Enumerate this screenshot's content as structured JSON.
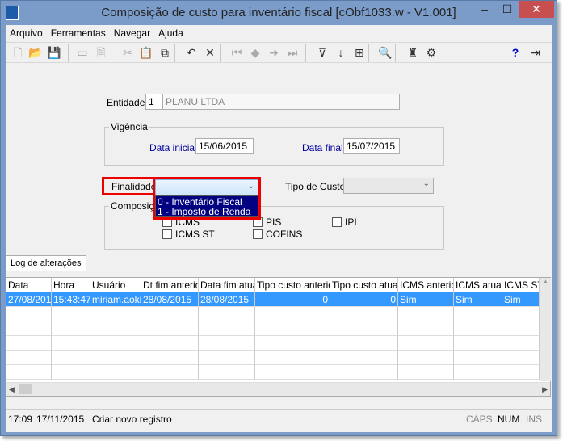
{
  "window": {
    "title": "Composição de custo para inventário fiscal [cObf1033.w - V1.001]"
  },
  "menu": [
    "Arquivo",
    "Ferramentas",
    "Navegar",
    "Ajuda"
  ],
  "toolbar": {
    "icons": [
      "new-icon",
      "open-icon",
      "save-icon",
      "window-icon",
      "properties-icon",
      "cut-icon",
      "paste-icon",
      "copy-icon",
      "undo-icon",
      "delete-icon",
      "first-icon",
      "prev-icon",
      "next-icon",
      "last-icon",
      "filter-icon",
      "sort-icon",
      "export-icon",
      "preview-icon",
      "find-icon",
      "config-icon",
      "help-icon",
      "exit-icon"
    ]
  },
  "form": {
    "entidade_label": "Entidade:",
    "entidade_code": "1",
    "entidade_name": "PLANU LTDA",
    "vigencia_label": "Vigência",
    "data_inicial_label": "Data inicial:",
    "data_inicial": "15/06/2015",
    "data_final_label": "Data final:",
    "data_final": "15/07/2015",
    "finalidade_label": "Finalidade",
    "finalidade_value": "",
    "finalidade_options": [
      "0 - Inventário Fiscal",
      "1 - Imposto de Renda"
    ],
    "tipo_custo_label": "Tipo de Custo:",
    "tipo_custo_value": "",
    "composicao_label": "Composição",
    "checks": [
      {
        "label": "ICMS",
        "checked": false
      },
      {
        "label": "PIS",
        "checked": false
      },
      {
        "label": "IPI",
        "checked": false
      },
      {
        "label": "ICMS ST",
        "checked": false
      },
      {
        "label": "COFINS",
        "checked": false
      }
    ]
  },
  "tab": "Log de alterações",
  "grid": {
    "columns": [
      "Data",
      "Hora",
      "Usuário",
      "Dt fim anterior",
      "Data fim atual",
      "Tipo custo anterior",
      "Tipo custo atual",
      "ICMS anterior",
      "ICMS atual",
      "ICMS ST"
    ],
    "rows": [
      [
        "27/08/201",
        "15:43:47",
        "miriam.aoki",
        "28/08/2015",
        "28/08/2015",
        "0",
        "0",
        "Sim",
        "Sim",
        "Sim"
      ]
    ]
  },
  "status": {
    "time": "17:09",
    "date": "17/11/2015",
    "message": "Criar novo registro",
    "caps": "CAPS",
    "num": "NUM",
    "ins": "INS"
  },
  "colors": {
    "highlight": "#e00000",
    "selection": "#3399ff",
    "dropdown": "#000080"
  }
}
